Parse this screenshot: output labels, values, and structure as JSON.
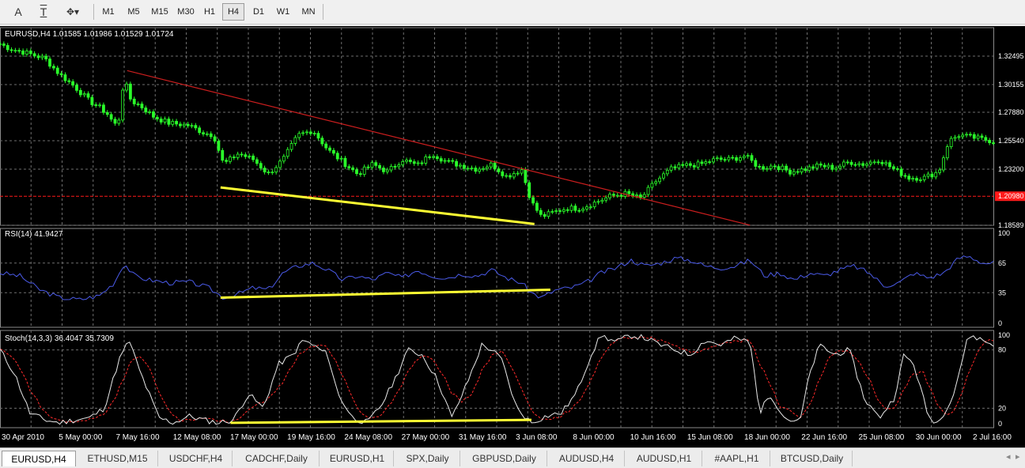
{
  "toolbar": {
    "tools": [
      {
        "name": "text-tool",
        "glyph": "A"
      },
      {
        "name": "text-label-tool",
        "glyph": "T"
      },
      {
        "name": "draw-shapes-tool",
        "glyph": "✥▾"
      }
    ],
    "timeframes": [
      "M1",
      "M5",
      "M15",
      "M30",
      "H1",
      "H4",
      "D1",
      "W1",
      "MN"
    ],
    "active_timeframe": "H4"
  },
  "chart": {
    "colors": {
      "background": "#000000",
      "grid": "#6e6e6e",
      "price_line": "#2aff2a",
      "text": "#ffffff",
      "rsi_line": "#4a5ae8",
      "stoch_main": "#e8e8e8",
      "stoch_signal": "#ff2a2a",
      "trendline_red": "#cc1e1e",
      "trendline_yellow": "#ffff33",
      "level_red": "#ff1a1a"
    },
    "main": {
      "header": "EURUSD,H4  1.01585 1.01986 1.01529 1.01724",
      "price_ticks": [
        "1.32495",
        "1.30155",
        "1.27880",
        "1.25540",
        "1.23200",
        "1.18589"
      ],
      "current_price_label": "1.20980",
      "ylim": [
        1.1859,
        1.3483
      ],
      "tick_values": [
        1.32495,
        1.30155,
        1.2788,
        1.2554,
        1.232,
        1.18589
      ],
      "level": 1.2098,
      "anchors": [
        [
          0,
          1.335
        ],
        [
          0.01,
          1.331
        ],
        [
          0.025,
          1.328
        ],
        [
          0.045,
          1.323
        ],
        [
          0.06,
          1.31
        ],
        [
          0.075,
          1.3
        ],
        [
          0.09,
          1.288
        ],
        [
          0.1,
          1.283
        ],
        [
          0.11,
          1.276
        ],
        [
          0.115,
          1.268
        ],
        [
          0.122,
          1.276
        ],
        [
          0.12,
          1.28
        ],
        [
          0.125,
          1.306
        ],
        [
          0.132,
          1.288
        ],
        [
          0.14,
          1.285
        ],
        [
          0.155,
          1.275
        ],
        [
          0.17,
          1.27
        ],
        [
          0.19,
          1.268
        ],
        [
          0.205,
          1.262
        ],
        [
          0.215,
          1.26
        ],
        [
          0.225,
          1.236
        ],
        [
          0.24,
          1.245
        ],
        [
          0.255,
          1.24
        ],
        [
          0.27,
          1.228
        ],
        [
          0.285,
          1.24
        ],
        [
          0.3,
          1.26
        ],
        [
          0.315,
          1.264
        ],
        [
          0.33,
          1.248
        ],
        [
          0.345,
          1.238
        ],
        [
          0.36,
          1.228
        ],
        [
          0.375,
          1.236
        ],
        [
          0.39,
          1.23
        ],
        [
          0.405,
          1.24
        ],
        [
          0.42,
          1.235
        ],
        [
          0.435,
          1.245
        ],
        [
          0.45,
          1.238
        ],
        [
          0.465,
          1.235
        ],
        [
          0.48,
          1.232
        ],
        [
          0.495,
          1.236
        ],
        [
          0.51,
          1.226
        ],
        [
          0.525,
          1.232
        ],
        [
          0.535,
          1.205
        ],
        [
          0.545,
          1.193
        ],
        [
          0.555,
          1.196
        ],
        [
          0.57,
          1.2
        ],
        [
          0.585,
          1.2
        ],
        [
          0.6,
          1.205
        ],
        [
          0.615,
          1.21
        ],
        [
          0.63,
          1.212
        ],
        [
          0.645,
          1.208
        ],
        [
          0.66,
          1.222
        ],
        [
          0.675,
          1.232
        ],
        [
          0.69,
          1.235
        ],
        [
          0.705,
          1.236
        ],
        [
          0.72,
          1.24
        ],
        [
          0.735,
          1.24
        ],
        [
          0.75,
          1.243
        ],
        [
          0.765,
          1.233
        ],
        [
          0.78,
          1.235
        ],
        [
          0.795,
          1.23
        ],
        [
          0.81,
          1.232
        ],
        [
          0.825,
          1.235
        ],
        [
          0.84,
          1.233
        ],
        [
          0.855,
          1.238
        ],
        [
          0.87,
          1.236
        ],
        [
          0.885,
          1.24
        ],
        [
          0.9,
          1.232
        ],
        [
          0.915,
          1.225
        ],
        [
          0.93,
          1.225
        ],
        [
          0.945,
          1.23
        ],
        [
          0.955,
          1.255
        ],
        [
          0.965,
          1.26
        ],
        [
          0.98,
          1.258
        ],
        [
          1,
          1.255
        ]
      ],
      "trendline_red": [
        [
          0.128,
          1.313
        ],
        [
          0.755,
          1.186
        ]
      ],
      "trendline_yellow": [
        [
          0.222,
          1.217
        ],
        [
          0.538,
          1.187
        ]
      ]
    },
    "rsi": {
      "label": "RSI(14) 41.9427",
      "levels": [
        "100",
        "65",
        "35",
        "0"
      ],
      "level_values": [
        100,
        65,
        35,
        0
      ],
      "anchors": [
        [
          0,
          55
        ],
        [
          0.02,
          52
        ],
        [
          0.04,
          38
        ],
        [
          0.06,
          30
        ],
        [
          0.08,
          28
        ],
        [
          0.1,
          32
        ],
        [
          0.115,
          45
        ],
        [
          0.125,
          65
        ],
        [
          0.135,
          52
        ],
        [
          0.15,
          48
        ],
        [
          0.17,
          45
        ],
        [
          0.19,
          46
        ],
        [
          0.21,
          40
        ],
        [
          0.225,
          30
        ],
        [
          0.24,
          34
        ],
        [
          0.255,
          40
        ],
        [
          0.27,
          38
        ],
        [
          0.285,
          55
        ],
        [
          0.3,
          62
        ],
        [
          0.315,
          65
        ],
        [
          0.33,
          58
        ],
        [
          0.345,
          48
        ],
        [
          0.36,
          52
        ],
        [
          0.375,
          48
        ],
        [
          0.39,
          55
        ],
        [
          0.405,
          50
        ],
        [
          0.42,
          58
        ],
        [
          0.435,
          52
        ],
        [
          0.45,
          50
        ],
        [
          0.465,
          54
        ],
        [
          0.48,
          52
        ],
        [
          0.495,
          58
        ],
        [
          0.51,
          50
        ],
        [
          0.525,
          45
        ],
        [
          0.535,
          35
        ],
        [
          0.545,
          30
        ],
        [
          0.56,
          38
        ],
        [
          0.575,
          40
        ],
        [
          0.59,
          45
        ],
        [
          0.605,
          55
        ],
        [
          0.62,
          60
        ],
        [
          0.635,
          68
        ],
        [
          0.65,
          62
        ],
        [
          0.665,
          65
        ],
        [
          0.68,
          70
        ],
        [
          0.695,
          68
        ],
        [
          0.71,
          62
        ],
        [
          0.725,
          60
        ],
        [
          0.74,
          62
        ],
        [
          0.755,
          68
        ],
        [
          0.77,
          52
        ],
        [
          0.785,
          55
        ],
        [
          0.8,
          48
        ],
        [
          0.815,
          55
        ],
        [
          0.83,
          52
        ],
        [
          0.845,
          58
        ],
        [
          0.86,
          62
        ],
        [
          0.875,
          55
        ],
        [
          0.89,
          42
        ],
        [
          0.905,
          45
        ],
        [
          0.92,
          55
        ],
        [
          0.935,
          50
        ],
        [
          0.95,
          55
        ],
        [
          0.965,
          70
        ],
        [
          0.975,
          72
        ],
        [
          0.99,
          65
        ],
        [
          1,
          65
        ]
      ],
      "trendline_yellow": [
        [
          0.222,
          30
        ],
        [
          0.554,
          38
        ]
      ]
    },
    "stoch": {
      "label": "Stoch(14,3,3) 36.4047 35.7309",
      "levels": [
        "100",
        "80",
        "20",
        "0"
      ],
      "level_values": [
        100,
        80,
        20,
        0
      ],
      "anchors": [
        [
          0,
          80
        ],
        [
          0.015,
          55
        ],
        [
          0.03,
          15
        ],
        [
          0.045,
          8
        ],
        [
          0.06,
          5
        ],
        [
          0.075,
          8
        ],
        [
          0.09,
          10
        ],
        [
          0.105,
          20
        ],
        [
          0.12,
          70
        ],
        [
          0.13,
          90
        ],
        [
          0.14,
          60
        ],
        [
          0.15,
          35
        ],
        [
          0.16,
          10
        ],
        [
          0.175,
          5
        ],
        [
          0.19,
          12
        ],
        [
          0.205,
          8
        ],
        [
          0.22,
          5
        ],
        [
          0.235,
          8
        ],
        [
          0.25,
          35
        ],
        [
          0.265,
          20
        ],
        [
          0.28,
          65
        ],
        [
          0.295,
          75
        ],
        [
          0.305,
          90
        ],
        [
          0.315,
          85
        ],
        [
          0.33,
          75
        ],
        [
          0.34,
          35
        ],
        [
          0.355,
          10
        ],
        [
          0.37,
          5
        ],
        [
          0.385,
          25
        ],
        [
          0.4,
          55
        ],
        [
          0.41,
          80
        ],
        [
          0.425,
          75
        ],
        [
          0.44,
          50
        ],
        [
          0.455,
          10
        ],
        [
          0.47,
          45
        ],
        [
          0.485,
          85
        ],
        [
          0.495,
          80
        ],
        [
          0.505,
          70
        ],
        [
          0.52,
          20
        ],
        [
          0.535,
          5
        ],
        [
          0.55,
          12
        ],
        [
          0.565,
          15
        ],
        [
          0.58,
          35
        ],
        [
          0.595,
          75
        ],
        [
          0.605,
          95
        ],
        [
          0.62,
          88
        ],
        [
          0.635,
          95
        ],
        [
          0.65,
          92
        ],
        [
          0.665,
          85
        ],
        [
          0.68,
          80
        ],
        [
          0.695,
          75
        ],
        [
          0.71,
          90
        ],
        [
          0.725,
          85
        ],
        [
          0.74,
          92
        ],
        [
          0.755,
          88
        ],
        [
          0.765,
          15
        ],
        [
          0.775,
          35
        ],
        [
          0.79,
          10
        ],
        [
          0.805,
          5
        ],
        [
          0.815,
          55
        ],
        [
          0.825,
          85
        ],
        [
          0.84,
          75
        ],
        [
          0.855,
          80
        ],
        [
          0.87,
          30
        ],
        [
          0.885,
          10
        ],
        [
          0.9,
          30
        ],
        [
          0.91,
          75
        ],
        [
          0.92,
          65
        ],
        [
          0.935,
          10
        ],
        [
          0.945,
          5
        ],
        [
          0.96,
          35
        ],
        [
          0.975,
          95
        ],
        [
          0.985,
          92
        ],
        [
          1,
          85
        ]
      ],
      "trendline_yellow": [
        [
          0.232,
          5
        ],
        [
          0.535,
          8
        ]
      ]
    },
    "time_labels": [
      "30 Apr 2010",
      "5 May 00:00",
      "7 May 16:00",
      "12 May 08:00",
      "17 May 00:00",
      "19 May 16:00",
      "24 May 08:00",
      "27 May 00:00",
      "31 May 16:00",
      "3 Jun 08:00",
      "8 Jun 00:00",
      "10 Jun 16:00",
      "15 Jun 08:00",
      "18 Jun 00:00",
      "22 Jun 16:00",
      "25 Jun 08:00",
      "30 Jun 00:00",
      "2 Jul 16:00"
    ]
  },
  "tabs": {
    "items": [
      "EURUSD,H4",
      "ETHUSD,M15",
      "USDCHF,H4",
      "CADCHF,Daily",
      "EURUSD,H1",
      "SPX,Daily",
      "GBPUSD,Daily",
      "AUDUSD,H4",
      "AUDUSD,H1",
      "#AAPL,H1",
      "BTCUSD,Daily"
    ],
    "active": "EURUSD,H4",
    "scroll_left_glyph": "◂",
    "scroll_right_glyph": "▸"
  }
}
